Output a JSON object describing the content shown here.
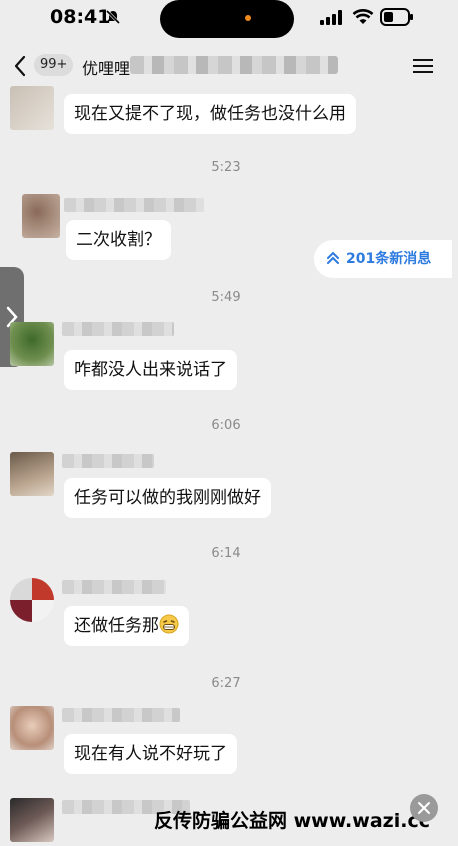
{
  "status_bar": {
    "time": "08:41"
  },
  "header": {
    "unread_count": "99+",
    "title": "优哩哩",
    "icons": [
      "back-icon",
      "menu-icon"
    ]
  },
  "new_messages": {
    "label": "201条新消息"
  },
  "messages": [
    {
      "text": "现在又提不了现，做任务也没什么用"
    },
    {
      "time": "5:23"
    },
    {
      "text": "二次收割？"
    },
    {
      "time": "5:49"
    },
    {
      "text": "咋都没人出来说话了"
    },
    {
      "time": "6:06"
    },
    {
      "text": "任务可以做的我刚刚做好"
    },
    {
      "time": "6:14"
    },
    {
      "text": "还做任务那"
    },
    {
      "time": "6:27"
    },
    {
      "text": "现在有人说不好玩了"
    }
  ],
  "watermark": {
    "text": "反传防骗公益网 www.wazi.cc"
  },
  "colors": {
    "background": "#ededed",
    "bubble": "#ffffff",
    "link": "#2e7be0"
  }
}
